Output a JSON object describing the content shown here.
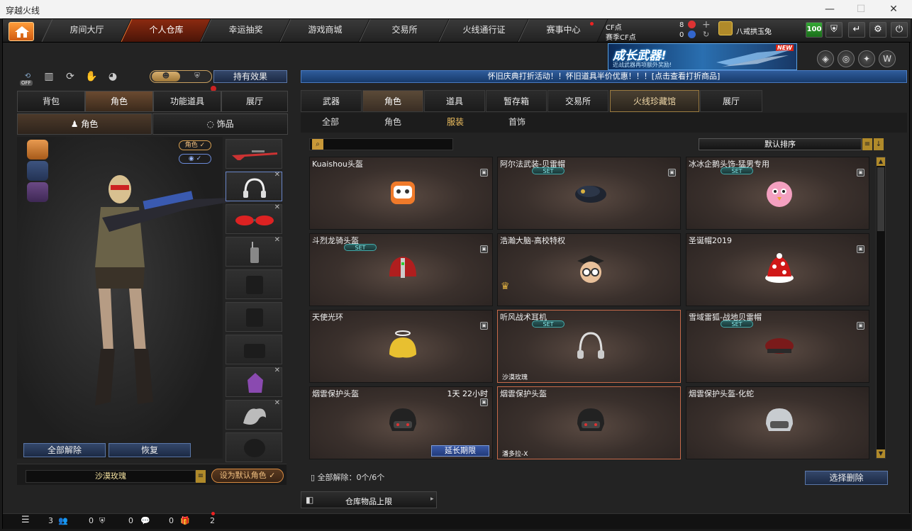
{
  "window": {
    "title": "穿越火线",
    "min": "—",
    "max": "☐",
    "close": "✕"
  },
  "nav": {
    "tabs": [
      "房间大厅",
      "个人仓库",
      "幸运抽奖",
      "游戏商城",
      "交易所",
      "火线通行证",
      "赛事中心"
    ],
    "active": 1
  },
  "currency": {
    "cf_label": "CF点",
    "cf_value": "8",
    "season_label": "赛季CF点",
    "season_value": "0"
  },
  "user": {
    "name": "八戒拱玉兔",
    "level": "100"
  },
  "banner": {
    "title": "成长武器!",
    "subtitle": "近战武器再项额外奖励!",
    "badge": "NEW"
  },
  "left": {
    "off_label": "OFF",
    "effects_button": "持有效果",
    "tabs": [
      "背包",
      "角色",
      "功能道具",
      "展厅"
    ],
    "active_tab": 1,
    "subtabs": [
      "角色",
      "饰品"
    ],
    "active_subtab": 0,
    "badge_role": "角色",
    "unequip_all": "全部解除",
    "restore": "恢复",
    "character_name": "沙漠玫瑰",
    "set_default": "设为默认角色"
  },
  "notice": "怀旧庆典打折活动！！怀旧道具半价优惠！！！[点击查看打折商品]",
  "right": {
    "tabs": [
      "武器",
      "角色",
      "道具",
      "暂存箱",
      "交易所",
      "火线珍藏馆",
      "展厅"
    ],
    "active_tab": 1,
    "highlight_tab": 5,
    "subtabs": [
      "全部",
      "角色",
      "服装",
      "首饰"
    ],
    "active_subtab": 2,
    "search_placeholder": "",
    "sort_label": "默认排序",
    "items": [
      {
        "name": "Kuaishou头盔",
        "set": "",
        "tag": "",
        "time": "",
        "extend": ""
      },
      {
        "name": "阿尔法武装-贝雷帽",
        "set": "SET",
        "tag": "",
        "time": "",
        "extend": ""
      },
      {
        "name": "冰冰企鹅头饰-猛男专用",
        "set": "SET",
        "tag": "",
        "time": "",
        "extend": ""
      },
      {
        "name": "斗烈龙骑头盔",
        "set": "SET",
        "tag": "",
        "time": "",
        "extend": ""
      },
      {
        "name": "浩瀚大脑-高校特权",
        "set": "",
        "tag": "",
        "time": "",
        "extend": ""
      },
      {
        "name": "圣诞帽2019",
        "set": "",
        "tag": "",
        "time": "",
        "extend": ""
      },
      {
        "name": "天使光环",
        "set": "",
        "tag": "",
        "time": "",
        "extend": ""
      },
      {
        "name": "听风战术耳机",
        "set": "SET",
        "tag": "沙漠玫瑰",
        "time": "",
        "extend": ""
      },
      {
        "name": "雪域雷狐-战地贝雷帽",
        "set": "SET",
        "tag": "",
        "time": "",
        "extend": ""
      },
      {
        "name": "烟雲保护头盔",
        "set": "",
        "tag": "",
        "time": "1天 22小时",
        "extend": "延长期限"
      },
      {
        "name": "烟雲保护头盔",
        "set": "",
        "tag": "潘多拉-X",
        "time": "",
        "extend": ""
      },
      {
        "name": "烟雲保护头盔-化蛇",
        "set": "",
        "tag": "",
        "time": "",
        "extend": ""
      }
    ],
    "unequip_status": "全部解除：0个/6个",
    "select_delete": "选择删除",
    "storage_limit": "仓库物品上限"
  },
  "status": {
    "c1": "3",
    "c2": "0",
    "c3": "0",
    "c4": "0",
    "c5": "2"
  }
}
